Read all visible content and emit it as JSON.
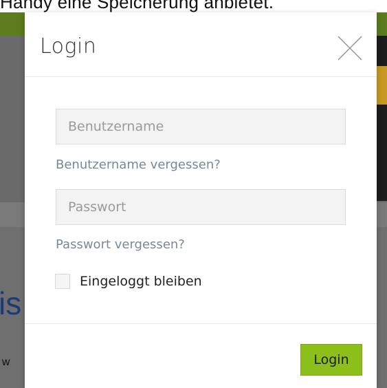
{
  "background": {
    "top_text": "Handy eine Speicherung anbietet.",
    "heading_fragment": "is",
    "body_fragment": "ı w"
  },
  "modal": {
    "title": "Login",
    "close_icon": "close-x-icon",
    "username": {
      "placeholder": "Benutzername",
      "value": ""
    },
    "forgot_username": "Benutzername vergessen?",
    "password": {
      "placeholder": "Passwort",
      "value": ""
    },
    "forgot_password": "Passwort vergessen?",
    "remember_me": {
      "label": "Eingeloggt bleiben",
      "checked": false
    },
    "submit_label": "Login"
  },
  "colors": {
    "login_button": "#8cbf1a",
    "header_bar": "#5c7c1e",
    "link": "#7a8894",
    "heading_blue": "#1d3a78"
  }
}
